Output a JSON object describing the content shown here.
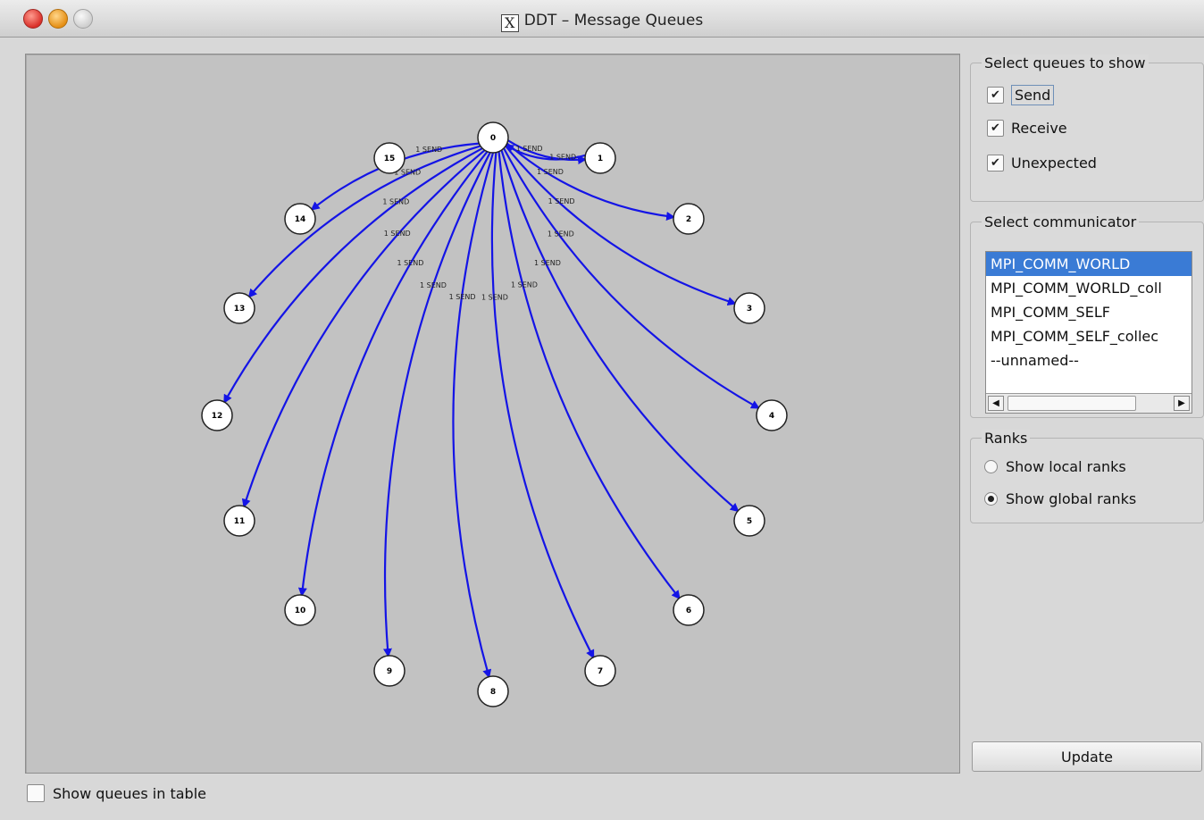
{
  "window": {
    "title": "DDT – Message Queues",
    "title_icon": "x11-icon",
    "buttons": [
      "close",
      "minimize",
      "maximize"
    ]
  },
  "graph": {
    "nodes": [
      "0",
      "1",
      "2",
      "3",
      "4",
      "5",
      "6",
      "7",
      "8",
      "9",
      "10",
      "11",
      "12",
      "13",
      "14",
      "15"
    ],
    "edge_label": "1 SEND",
    "edges": [
      {
        "from": "0",
        "to": "1"
      },
      {
        "from": "0",
        "to": "2"
      },
      {
        "from": "0",
        "to": "3"
      },
      {
        "from": "0",
        "to": "4"
      },
      {
        "from": "0",
        "to": "5"
      },
      {
        "from": "0",
        "to": "6"
      },
      {
        "from": "0",
        "to": "7"
      },
      {
        "from": "0",
        "to": "8"
      },
      {
        "from": "0",
        "to": "9"
      },
      {
        "from": "0",
        "to": "10"
      },
      {
        "from": "0",
        "to": "11"
      },
      {
        "from": "0",
        "to": "12"
      },
      {
        "from": "0",
        "to": "13"
      },
      {
        "from": "0",
        "to": "14"
      },
      {
        "from": "1",
        "to": "0"
      }
    ],
    "edge_color": "#1414e6"
  },
  "queues": {
    "title": "Select queues to show",
    "items": [
      {
        "label": "Send",
        "checked": true
      },
      {
        "label": "Receive",
        "checked": true
      },
      {
        "label": "Unexpected",
        "checked": true
      }
    ]
  },
  "communicator": {
    "title": "Select communicator",
    "items": [
      "MPI_COMM_WORLD",
      "MPI_COMM_WORLD_coll",
      "MPI_COMM_SELF",
      "MPI_COMM_SELF_collec",
      "--unnamed--"
    ],
    "selected_index": 0
  },
  "ranks": {
    "title": "Ranks",
    "options": [
      {
        "label": "Show local ranks",
        "selected": false
      },
      {
        "label": "Show global ranks",
        "selected": true
      }
    ]
  },
  "update_button": "Update",
  "bottom": {
    "show_queues_label": "Show queues in table",
    "checked": false
  },
  "colors": {
    "selection": "#3a7bd5",
    "panel": "#c2c2c2"
  }
}
